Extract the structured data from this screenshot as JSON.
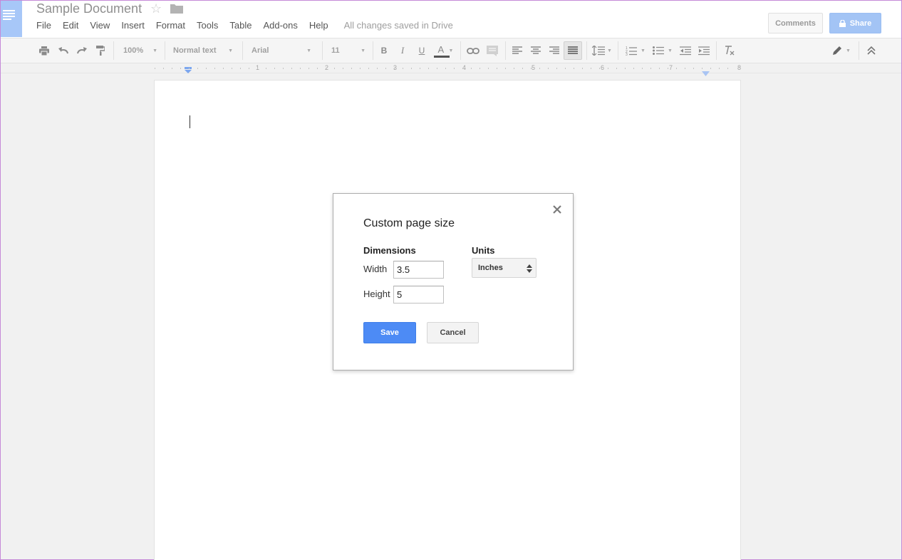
{
  "header": {
    "doc_title": "Sample Document",
    "star_icon": "star-icon",
    "folder_icon": "folder-icon",
    "menu": [
      "File",
      "Edit",
      "View",
      "Insert",
      "Format",
      "Tools",
      "Table",
      "Add-ons",
      "Help"
    ],
    "saved_status": "All changes saved in Drive",
    "comments_label": "Comments",
    "share_label": "Share"
  },
  "toolbar": {
    "zoom": "100%",
    "style": "Normal text",
    "font": "Arial",
    "font_size": "11",
    "bold": "B",
    "italic": "I",
    "underline": "U",
    "text_color": "A"
  },
  "ruler": {
    "numbers": [
      "1",
      "2",
      "3",
      "4",
      "5",
      "6",
      "7",
      "8"
    ]
  },
  "dialog": {
    "title": "Custom page size",
    "dimensions_label": "Dimensions",
    "units_label": "Units",
    "width_label": "Width",
    "width_value": "3.5",
    "height_label": "Height",
    "height_value": "5",
    "units_value": "Inches",
    "save_label": "Save",
    "cancel_label": "Cancel"
  },
  "colors": {
    "accent": "#4d8bf5",
    "share": "#a3c4f5",
    "logo": "#a7c7f8"
  }
}
